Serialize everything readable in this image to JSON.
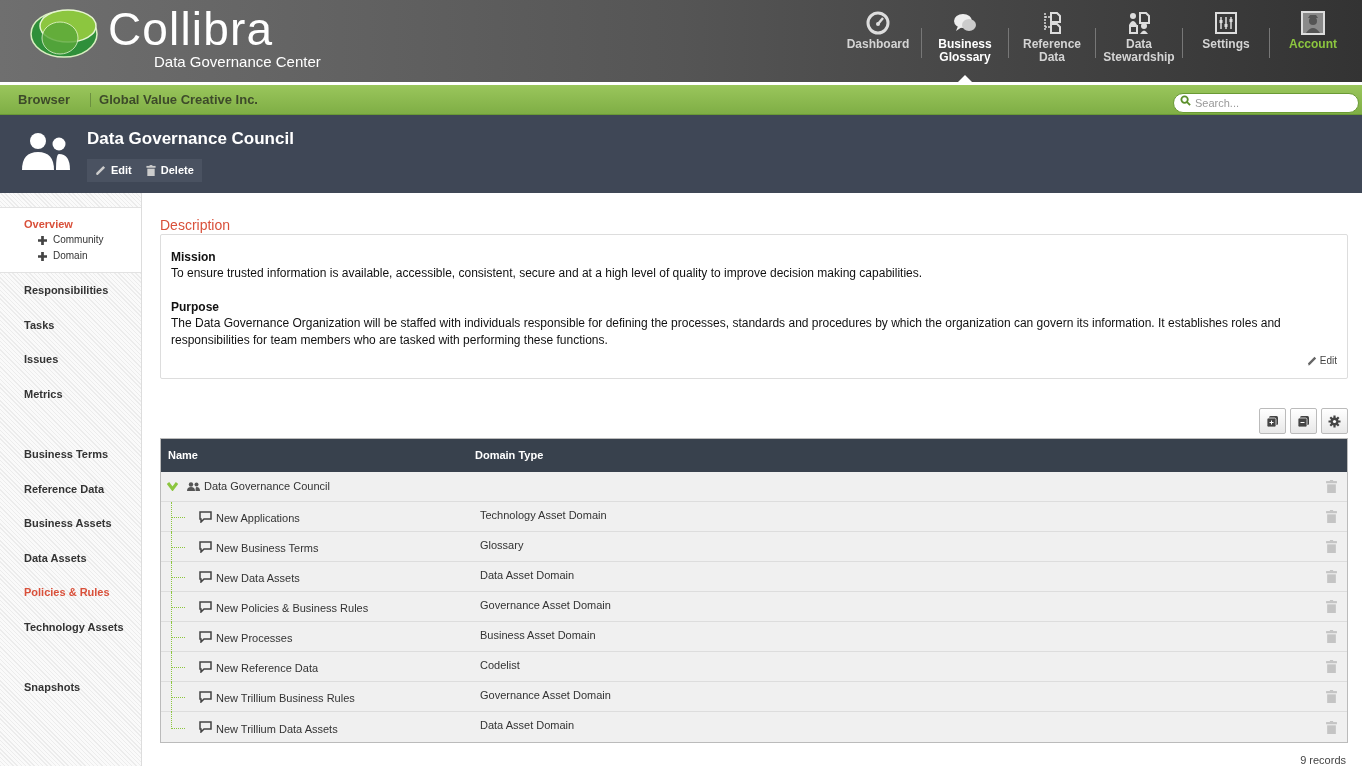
{
  "header": {
    "logo": {
      "name": "Collibra",
      "tagline": "Data Governance Center"
    },
    "nav": [
      {
        "label": "Dashboard",
        "kind": "dashboard",
        "selected": false
      },
      {
        "label": "Business Glossary",
        "kind": "glossary",
        "selected": true
      },
      {
        "label": "Reference Data",
        "kind": "reference",
        "selected": false
      },
      {
        "label": "Data Stewardship",
        "kind": "stewardship",
        "selected": false
      },
      {
        "label": "Settings",
        "kind": "settings",
        "selected": false
      },
      {
        "label": "Account",
        "kind": "account",
        "selected": false
      }
    ]
  },
  "breadcrumb": [
    "Browser",
    "Global Value Creative Inc."
  ],
  "search": {
    "placeholder": "Search..."
  },
  "banner": {
    "title": "Data Governance Council",
    "actions": [
      {
        "label": "Edit",
        "kind": "edit"
      },
      {
        "label": "Delete",
        "kind": "delete"
      }
    ]
  },
  "sidebar": {
    "groups": [
      [
        {
          "label": "Overview",
          "active": true,
          "children": [
            "Community",
            "Domain"
          ]
        },
        {
          "label": "Responsibilities",
          "active": false
        },
        {
          "label": "Tasks",
          "active": false
        },
        {
          "label": "Issues",
          "active": false
        },
        {
          "label": "Metrics",
          "active": false
        }
      ],
      [
        {
          "label": "Business Terms",
          "active": false
        },
        {
          "label": "Reference Data",
          "active": false
        },
        {
          "label": "Business Assets",
          "active": false
        },
        {
          "label": "Data Assets",
          "active": false
        },
        {
          "label": "Policies & Rules",
          "active": true
        },
        {
          "label": "Technology Assets",
          "active": false
        }
      ],
      [
        {
          "label": "Snapshots",
          "active": false
        }
      ]
    ]
  },
  "description": {
    "title": "Description",
    "sections": [
      {
        "heading": "Mission",
        "text": "To ensure trusted information is available, accessible, consistent, secure and at a high level of quality to improve decision making capabilities."
      },
      {
        "heading": "Purpose",
        "text": "The Data Governance Organization will be staffed with individuals responsible for defining the processes, standards and procedures by which the organization can govern its information. It establishes roles and responsibilities for team members who are tasked with performing these functions."
      }
    ],
    "edit_link": "Edit"
  },
  "table": {
    "columns": [
      "Name",
      "Domain Type"
    ],
    "rows": [
      {
        "name": "Data Governance Council",
        "expanded": true,
        "children": [
          {
            "name": "New Applications",
            "domain_type": "Technology Asset Domain"
          },
          {
            "name": "New Business Terms",
            "domain_type": "Glossary"
          },
          {
            "name": "New Data Assets",
            "domain_type": "Data Asset Domain"
          },
          {
            "name": "New Policies & Business Rules",
            "domain_type": "Governance Asset Domain"
          },
          {
            "name": "New Processes",
            "domain_type": "Business Asset Domain"
          },
          {
            "name": "New Reference Data",
            "domain_type": "Codelist"
          },
          {
            "name": "New Trillium Business Rules",
            "domain_type": "Governance Asset Domain"
          },
          {
            "name": "New Trillium Data Assets",
            "domain_type": "Data Asset Domain"
          }
        ]
      }
    ],
    "record_count": "9 records"
  }
}
